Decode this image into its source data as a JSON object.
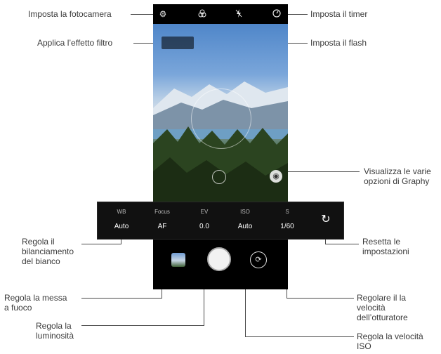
{
  "callouts": {
    "settings": "Imposta la fotocamera",
    "filter": "Applica l’effetto filtro",
    "timer": "Imposta il timer",
    "flash": "Imposta il flash",
    "graphy": "Visualizza le varie\nopzioni di Graphy",
    "wb": "Regola il\nbilanciamento\ndel bianco",
    "reset": "Resetta le\nimpostazioni",
    "focus": "Regola la messa\na fuoco",
    "brightness": "Regola la\nluminosità",
    "shutter": "Regolare il la\nvelocità\ndell’otturatore",
    "iso": "Regola la velocità\nISO"
  },
  "manual": {
    "params": [
      {
        "label": "WB",
        "value": "Auto"
      },
      {
        "label": "Focus",
        "value": "AF"
      },
      {
        "label": "EV",
        "value": "0.0"
      },
      {
        "label": "ISO",
        "value": "Auto"
      },
      {
        "label": "S",
        "value": "1/60"
      }
    ],
    "reset_icon": "reset-icon"
  },
  "icons": {
    "settings": "gear-icon",
    "filter": "filter-icon",
    "flash": "flash-icon",
    "timer": "timer-icon",
    "graphy": "graphy-icon",
    "switch": "switch-camera-icon"
  }
}
